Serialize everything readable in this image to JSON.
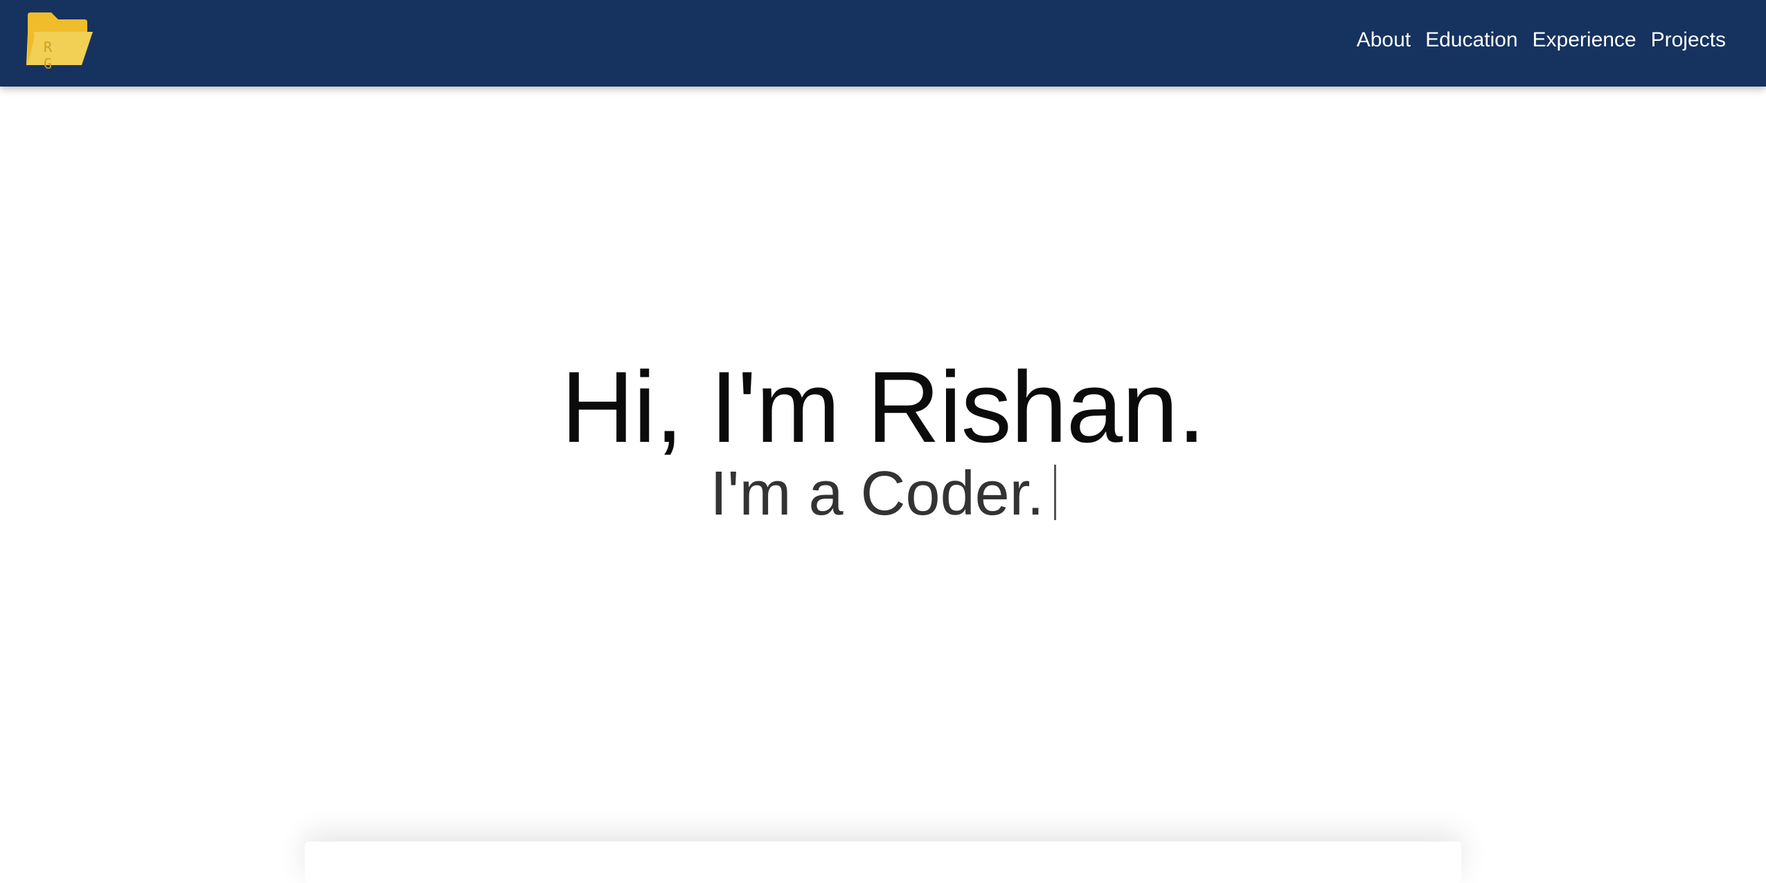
{
  "brand": {
    "logo_icon": "folder-icon",
    "logo_text": "R G",
    "logo_color": "#f0c233",
    "nav_bg": "#16325f"
  },
  "nav": {
    "items": [
      {
        "label": "About"
      },
      {
        "label": "Education"
      },
      {
        "label": "Experience"
      },
      {
        "label": "Projects"
      }
    ]
  },
  "hero": {
    "title": "Hi, I'm Rishan.",
    "subtitle": "I'm a Coder."
  }
}
